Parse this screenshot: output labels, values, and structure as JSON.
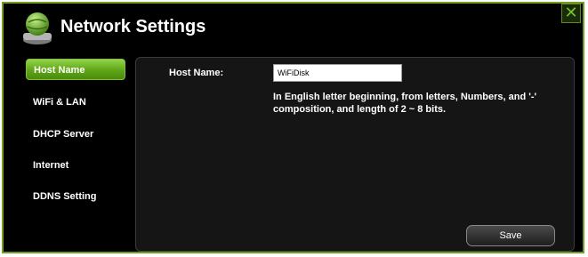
{
  "window": {
    "title": "Network Settings",
    "close_label": "✕",
    "accent_color": "#6f9e24"
  },
  "sidebar": {
    "items": [
      {
        "label": "Host Name",
        "active": true
      },
      {
        "label": "WiFi & LAN",
        "active": false
      },
      {
        "label": "DHCP Server",
        "active": false
      },
      {
        "label": "Internet",
        "active": false
      },
      {
        "label": "DDNS Setting",
        "active": false
      }
    ]
  },
  "form": {
    "host_name_label": "Host Name:",
    "host_name_value": "WiFiDisk",
    "hint": "In English letter beginning, from letters, Numbers, and '-' composition, and length of 2 ~ 8 bits.",
    "save_label": "Save"
  },
  "icons": {
    "app": "network-globe-icon",
    "close": "close-icon"
  }
}
